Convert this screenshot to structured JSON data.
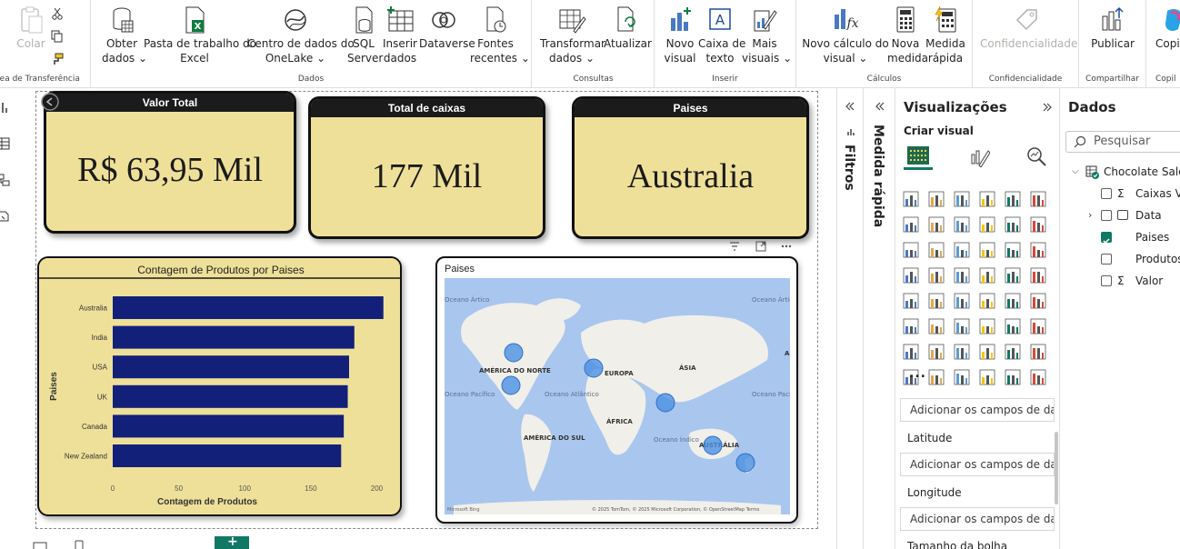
{
  "ribbon": {
    "groups": [
      {
        "label": "Área de Transferência"
      },
      {
        "label": "Dados"
      },
      {
        "label": "Consultas"
      },
      {
        "label": "Inserir"
      },
      {
        "label": "Cálculos"
      },
      {
        "label": "Confidencialidade"
      },
      {
        "label": "Compartilhar"
      },
      {
        "label": "Copil"
      }
    ],
    "buttons": {
      "colar": "Colar",
      "obter1": "Obter",
      "obter2": "dados",
      "pasta1": "Pasta de trabalho do",
      "pasta2": "Excel",
      "centro1": "Centro de dados do",
      "centro2": "OneLake",
      "sql1": "SQL",
      "sql2": "Server",
      "inserir1": "Inserir",
      "inserir2": "dados",
      "dataverse": "Dataverse",
      "fontes1": "Fontes",
      "fontes2": "recentes",
      "transformar1": "Transformar",
      "transformar2": "dados",
      "atualizar": "Atualizar",
      "novovisual1": "Novo",
      "novovisual2": "visual",
      "caixa1": "Caixa de",
      "caixa2": "texto",
      "mais1": "Mais",
      "mais2": "visuais",
      "novocalc1": "Novo cálculo do",
      "novocalc2": "visual",
      "novamedida1": "Nova",
      "novamedida2": "medida",
      "medidarapida1": "Medida",
      "medidarapida2": "rápida",
      "confidencialidade": "Confidencialidade",
      "publicar": "Publicar",
      "copilot": "Copil"
    },
    "chevron": "⌄"
  },
  "cards": [
    {
      "title": "Valor Total",
      "value": "R$ 63,95 Mil"
    },
    {
      "title": "Total de caixas",
      "value": "177 Mil"
    },
    {
      "title": "Paises",
      "value": "Australia"
    }
  ],
  "map": {
    "title": "Paises",
    "labels": {
      "na": "AMÉRICA DO NORTE",
      "eu": "EUROPA",
      "asia": "ÁSIA",
      "africa": "ÁFRICA",
      "sa": "AMÉRICA DO SUL",
      "aus": "AUSTRÁLIA",
      "oceano_artico_l": "Oceano Ártico",
      "oceano_artico_r": "Oceano Ártico",
      "oceano_pacifico_l": "Oceano Pacífico",
      "oceano_atlantico": "Oceano Atlântico",
      "oceano_indico": "Oceano Índico",
      "oceano_pacifico_r": "Oceano Pacífico",
      "a": "A"
    },
    "attribution": "© 2025 TomTom, © 2025 Microsoft Corporation, © OpenStreetMap  Terms",
    "bing": "Microsoft Bing"
  },
  "chart_data": {
    "type": "bar",
    "title": "Contagem de Produtos por Paises",
    "xlabel": "Contagem de Produtos",
    "ylabel": "Paises",
    "categories": [
      "Australia",
      "India",
      "USA",
      "UK",
      "Canada",
      "New Zealand"
    ],
    "values": [
      205,
      183,
      179,
      178,
      175,
      173
    ],
    "xlim": [
      0,
      210
    ],
    "xticks": [
      "0",
      "50",
      "100",
      "150",
      "200"
    ],
    "bar_color": "#12207a",
    "grid": false
  },
  "panes": {
    "filtros": "Filtros",
    "medida_rapida": "Medida rápida",
    "visualizacoes": "Visualizações",
    "criar_visual": "Criar visual",
    "more": "...",
    "wells": [
      {
        "label": "",
        "placeholder": "Adicionar os campos de da..."
      },
      {
        "label": "Latitude",
        "placeholder": "Adicionar os campos de da..."
      },
      {
        "label": "Longitude",
        "placeholder": "Adicionar os campos de da..."
      },
      {
        "label": "Tamanho da bolha",
        "placeholder": ""
      }
    ],
    "dados": "Dados",
    "search_placeholder": "Pesquisar",
    "table": "Chocolate Sales",
    "fields": [
      {
        "name": "Caixas Ve",
        "sigma": true,
        "checked": false
      },
      {
        "name": "Data",
        "sigma": false,
        "checked": false
      },
      {
        "name": "Paises",
        "sigma": false,
        "checked": true
      },
      {
        "name": "Produtos",
        "sigma": false,
        "checked": false
      },
      {
        "name": "Valor",
        "sigma": true,
        "checked": false
      }
    ],
    "sigma": "Σ"
  },
  "colors": {
    "card_fill": "#efe099",
    "card_border": "#111111",
    "accent": "#117865"
  }
}
